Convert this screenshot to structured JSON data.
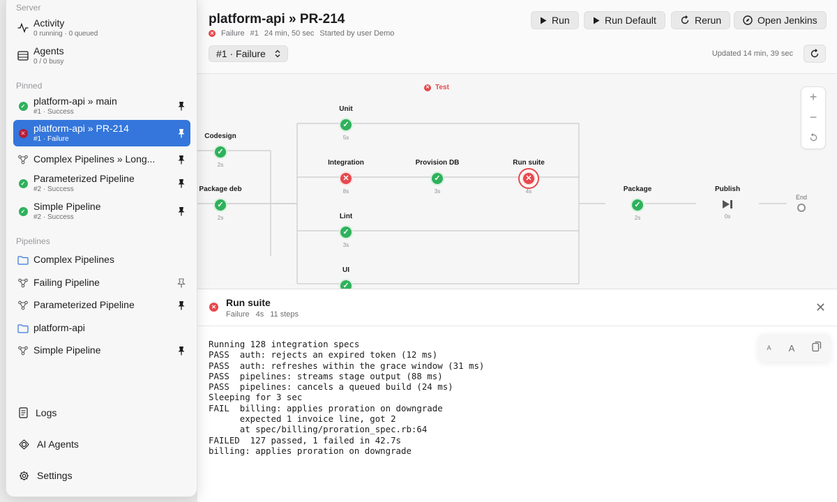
{
  "sidebar": {
    "server_header": "Server",
    "activity": {
      "title": "Activity",
      "subtitle": "0 running · 0 queued",
      "icon": "activity-icon"
    },
    "agents": {
      "title": "Agents",
      "subtitle": "0 / 0 busy",
      "icon": "server-rack-icon"
    },
    "pinned_header": "Pinned",
    "pinned": [
      {
        "title": "platform-api » main",
        "subtitle": "#1 · Success",
        "status": "success"
      },
      {
        "title": "platform-api » PR-214",
        "subtitle": "#1 · Failure",
        "status": "failure"
      },
      {
        "title": "Complex Pipelines » Long...",
        "subtitle": "",
        "status": "pipeline"
      },
      {
        "title": "Parameterized Pipeline",
        "subtitle": "#2 · Success",
        "status": "success"
      },
      {
        "title": "Simple Pipeline",
        "subtitle": "#2 · Success",
        "status": "success"
      }
    ],
    "pipelines_header": "Pipelines",
    "pipelines": [
      {
        "title": "Complex Pipelines",
        "type": "folder"
      },
      {
        "title": "Failing Pipeline",
        "type": "pipeline"
      },
      {
        "title": "Parameterized Pipeline",
        "type": "pipeline"
      },
      {
        "title": "platform-api",
        "type": "folder"
      },
      {
        "title": "Simple Pipeline",
        "type": "pipeline"
      }
    ],
    "bottom": {
      "logs": "Logs",
      "ai_agents": "AI Agents",
      "settings": "Settings"
    }
  },
  "header": {
    "title": "platform-api » PR-214",
    "status": "Failure",
    "build": "#1",
    "duration": "24 min, 50 sec",
    "started_by": "Started by user Demo",
    "run_select": "#1 · Failure",
    "updated": "Updated 14 min, 39 sec",
    "buttons": {
      "run": "Run",
      "run_default": "Run Default",
      "rerun": "Rerun",
      "open_jenkins": "Open Jenkins"
    }
  },
  "graph": {
    "group_label": "Test",
    "stages": {
      "codesign": {
        "name": "Codesign",
        "duration": "2s",
        "status": "success"
      },
      "package_deb": {
        "name": "Package deb",
        "duration": "2s",
        "status": "success"
      },
      "unit": {
        "name": "Unit",
        "duration": "5s",
        "status": "success"
      },
      "integration": {
        "name": "Integration",
        "duration": "8s",
        "status": "failure"
      },
      "provision_db": {
        "name": "Provision DB",
        "duration": "3s",
        "status": "success"
      },
      "run_suite": {
        "name": "Run suite",
        "duration": "4s",
        "status": "failure"
      },
      "lint": {
        "name": "Lint",
        "duration": "3s",
        "status": "success"
      },
      "ui": {
        "name": "UI",
        "duration": "",
        "status": "success"
      },
      "package": {
        "name": "Package",
        "duration": "2s",
        "status": "success"
      },
      "publish": {
        "name": "Publish",
        "duration": "0s",
        "status": "skipped"
      },
      "end": {
        "name": "End"
      }
    }
  },
  "log_panel": {
    "title": "Run suite",
    "status": "Failure",
    "duration": "4s",
    "steps": "11 steps",
    "font_small": "A",
    "font_large": "A",
    "lines": [
      "Running 128 integration specs",
      "PASS  auth: rejects an expired token (12 ms)",
      "PASS  auth: refreshes within the grace window (31 ms)",
      "PASS  pipelines: streams stage output (88 ms)",
      "PASS  pipelines: cancels a queued build (24 ms)",
      "Sleeping for 3 sec",
      "FAIL  billing: applies proration on downgrade",
      "      expected 1 invoice line, got 2",
      "      at spec/billing/proration_spec.rb:64",
      "FAILED  127 passed, 1 failed in 42.7s",
      "billing: applies proration on downgrade"
    ]
  },
  "colors": {
    "accent": "#3476db",
    "success": "#2fb15c",
    "failure": "#e5484d"
  }
}
